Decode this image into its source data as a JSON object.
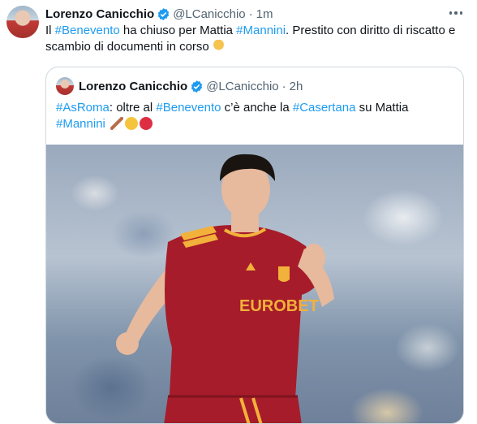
{
  "tweet": {
    "author_name": "Lorenzo Canicchio",
    "handle": "@LCanicchio",
    "separator": "·",
    "time": "1m",
    "text_parts": [
      {
        "text": "Il ",
        "tag": false
      },
      {
        "text": "#Benevento",
        "tag": true
      },
      {
        "text": " ha chiuso per Mattia ",
        "tag": false
      },
      {
        "text": "#Mannini",
        "tag": true
      },
      {
        "text": ". Prestito con diritto di riscatto e scambio di documenti in corso ",
        "tag": false
      }
    ]
  },
  "quoted": {
    "author_name": "Lorenzo Canicchio",
    "handle": "@LCanicchio",
    "separator": "·",
    "time": "2h",
    "text_parts": [
      {
        "text": "#AsRoma",
        "tag": true
      },
      {
        "text": ": oltre al ",
        "tag": false
      },
      {
        "text": "#Benevento",
        "tag": true
      },
      {
        "text": " c’è anche la ",
        "tag": false
      },
      {
        "text": "#Casertana",
        "tag": true
      },
      {
        "text": " su Mattia ",
        "tag": false
      },
      {
        "text": "#Mannini",
        "tag": true
      },
      {
        "text": " ",
        "tag": false
      }
    ],
    "jersey_sponsor": "EUROBET"
  },
  "icons": [
    "verified-badge-icon",
    "more-options-icon",
    "pointing-down-hand-emoji",
    "quill-emoji",
    "yellow-circle-emoji",
    "red-circle-emoji"
  ],
  "colors": {
    "link": "#1d9bf0",
    "muted": "#536471",
    "verified": "#1d9bf0",
    "jersey": "#a61c2a"
  }
}
